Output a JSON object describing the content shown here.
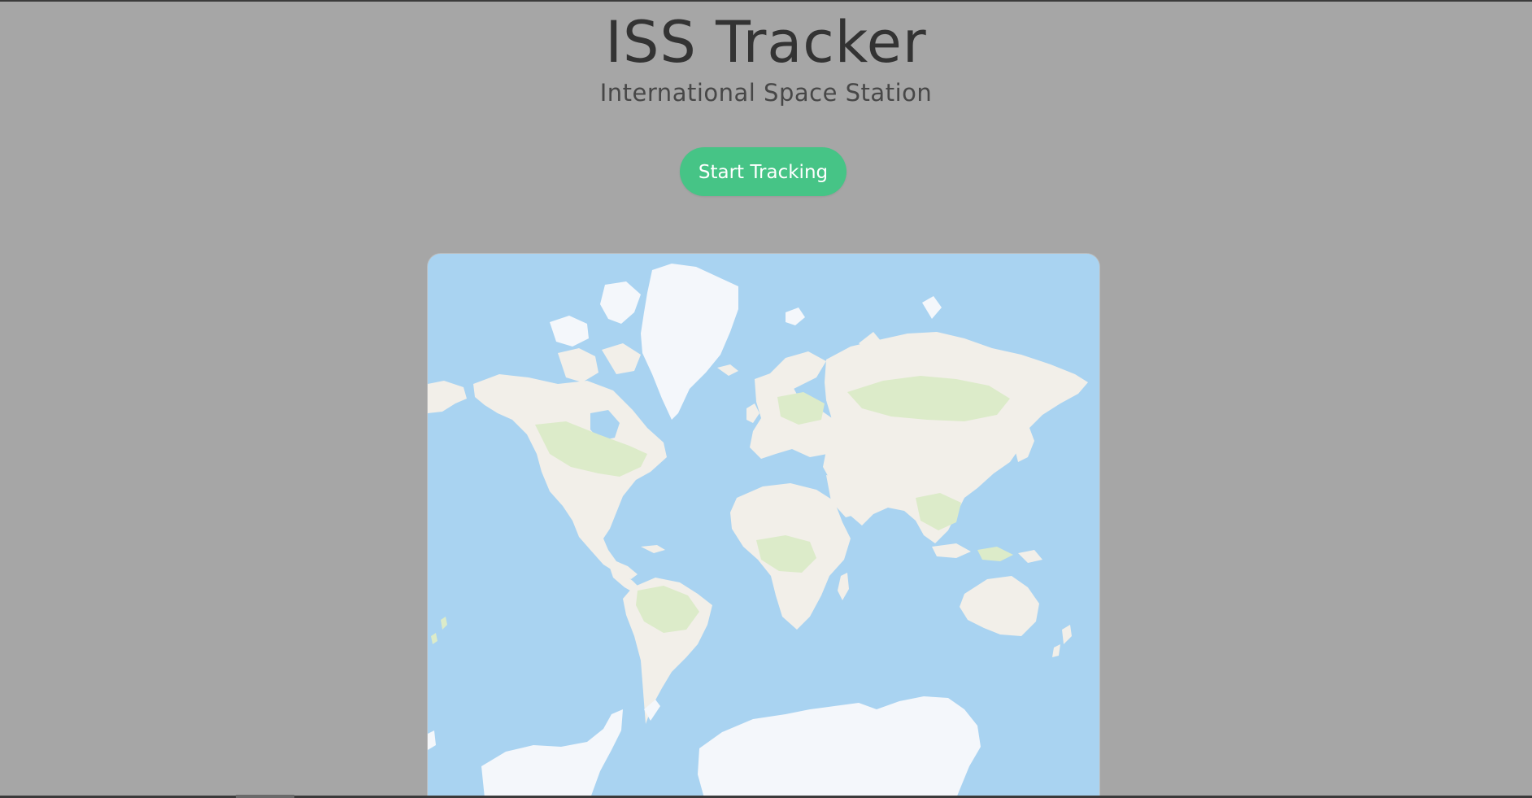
{
  "header": {
    "title": "ISS Tracker",
    "subtitle": "International Space Station"
  },
  "controls": {
    "start_label": "Start Tracking"
  },
  "map": {
    "ocean_color": "#a9d3f1",
    "land_color": "#f2efe9",
    "vegetation_color": "#dcebc9",
    "ice_color": "#f4f7fb"
  },
  "colors": {
    "page_background": "#a6a6a6",
    "accent": "#46c486",
    "title_text": "#333333"
  }
}
